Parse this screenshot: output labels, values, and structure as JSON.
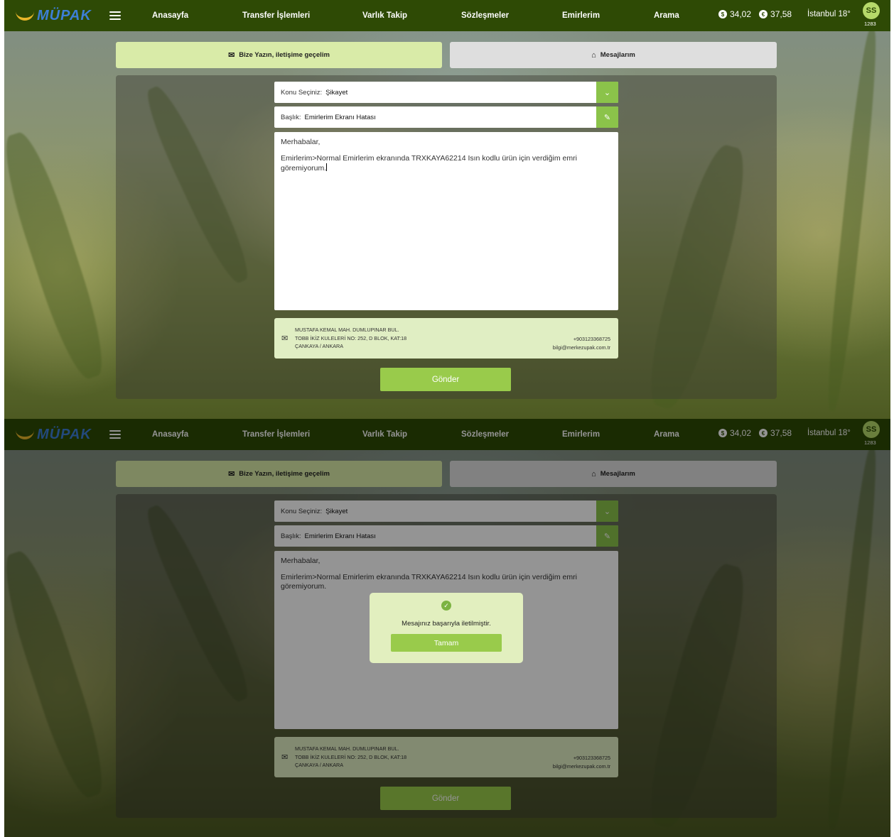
{
  "header": {
    "logo_text": "MÜPAK",
    "nav": [
      "Anasayfa",
      "Transfer İşlemleri",
      "Varlık Takip",
      "Sözleşmeler",
      "Emirlerim",
      "Arama"
    ],
    "rate_usd_symbol": "$",
    "rate_usd": "34,02",
    "rate_eur_symbol": "€",
    "rate_eur": "37,58",
    "weather": "İstanbul 18°",
    "avatar_initials": "SS",
    "avatar_number": "1283"
  },
  "tabs": {
    "contact_label": "Bize Yazın, iletişime geçelim",
    "messages_label": "Mesajlarım"
  },
  "form": {
    "subject_label": "Konu Seçiniz:",
    "subject_value": "Şikayet",
    "title_label": "Başlık:",
    "title_value": "Emirlerim Ekranı Hatası",
    "message_greeting": "Merhabalar,",
    "message_body": "Emirlerim>Normal Emirlerim ekranında TRXKAYA62214 Isın kodlu ürün için verdiğim emri göremiyorum."
  },
  "contact": {
    "address_line1": "MUSTAFA KEMAL MAH. DUMLUPINAR BUL.",
    "address_line2": "TOBB İKİZ KULELERİ NO: 252, D BLOK, KAT:18",
    "address_line3": "ÇANKAYA / ANKARA",
    "phone": "+903123368725",
    "email": "bilgi@merkezupak.com.tr"
  },
  "send_label": "Gönder",
  "dialog": {
    "message": "Mesajınız başarıyla iletilmiştir.",
    "ok_label": "Tamam"
  },
  "icons": {
    "menu": "hamburger-icon",
    "envelope": "envelope-icon",
    "inbox": "inbox-icon",
    "dropdown": "chevron-down-icon",
    "edit": "pencil-icon",
    "success": "check-circle-icon"
  },
  "colors": {
    "topbar": "#2e4a05",
    "accent": "#8bc34a",
    "button": "#99cb4b",
    "active_tab": "#d9eba8",
    "inactive_tab": "#dedede"
  }
}
